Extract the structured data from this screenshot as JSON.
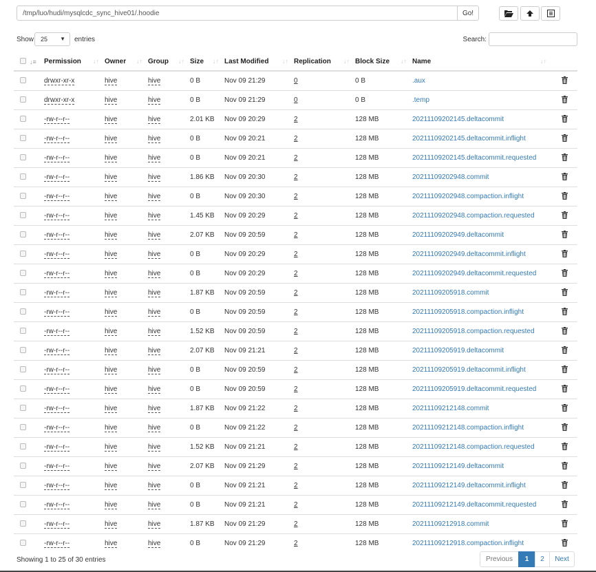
{
  "path": {
    "value": "/tmp/luo/hudi/mysqlcdc_sync_hive01/.hoodie",
    "go_label": "Go!"
  },
  "toolbar": {
    "icons": [
      "folder-open-icon",
      "upload-icon",
      "list-alt-icon"
    ]
  },
  "length": {
    "show_label": "Show",
    "selected": "25",
    "entries_label": "entries"
  },
  "search": {
    "label": "Search:",
    "value": ""
  },
  "columns": [
    "Permission",
    "Owner",
    "Group",
    "Size",
    "Last Modified",
    "Replication",
    "Block Size",
    "Name"
  ],
  "rows": [
    {
      "perm": "drwxr-xr-x",
      "owner": "hive",
      "group": "hive",
      "size": "0 B",
      "mod": "Nov 09 21:29",
      "rep": "0",
      "block": "0 B",
      "name": ".aux"
    },
    {
      "perm": "drwxr-xr-x",
      "owner": "hive",
      "group": "hive",
      "size": "0 B",
      "mod": "Nov 09 21:29",
      "rep": "0",
      "block": "0 B",
      "name": ".temp"
    },
    {
      "perm": "-rw-r--r--",
      "owner": "hive",
      "group": "hive",
      "size": "2.01 KB",
      "mod": "Nov 09 20:29",
      "rep": "2",
      "block": "128 MB",
      "name": "20211109202145.deltacommit"
    },
    {
      "perm": "-rw-r--r--",
      "owner": "hive",
      "group": "hive",
      "size": "0 B",
      "mod": "Nov 09 20:21",
      "rep": "2",
      "block": "128 MB",
      "name": "20211109202145.deltacommit.inflight"
    },
    {
      "perm": "-rw-r--r--",
      "owner": "hive",
      "group": "hive",
      "size": "0 B",
      "mod": "Nov 09 20:21",
      "rep": "2",
      "block": "128 MB",
      "name": "20211109202145.deltacommit.requested"
    },
    {
      "perm": "-rw-r--r--",
      "owner": "hive",
      "group": "hive",
      "size": "1.86 KB",
      "mod": "Nov 09 20:30",
      "rep": "2",
      "block": "128 MB",
      "name": "20211109202948.commit"
    },
    {
      "perm": "-rw-r--r--",
      "owner": "hive",
      "group": "hive",
      "size": "0 B",
      "mod": "Nov 09 20:30",
      "rep": "2",
      "block": "128 MB",
      "name": "20211109202948.compaction.inflight"
    },
    {
      "perm": "-rw-r--r--",
      "owner": "hive",
      "group": "hive",
      "size": "1.45 KB",
      "mod": "Nov 09 20:29",
      "rep": "2",
      "block": "128 MB",
      "name": "20211109202948.compaction.requested"
    },
    {
      "perm": "-rw-r--r--",
      "owner": "hive",
      "group": "hive",
      "size": "2.07 KB",
      "mod": "Nov 09 20:59",
      "rep": "2",
      "block": "128 MB",
      "name": "20211109202949.deltacommit"
    },
    {
      "perm": "-rw-r--r--",
      "owner": "hive",
      "group": "hive",
      "size": "0 B",
      "mod": "Nov 09 20:29",
      "rep": "2",
      "block": "128 MB",
      "name": "20211109202949.deltacommit.inflight"
    },
    {
      "perm": "-rw-r--r--",
      "owner": "hive",
      "group": "hive",
      "size": "0 B",
      "mod": "Nov 09 20:29",
      "rep": "2",
      "block": "128 MB",
      "name": "20211109202949.deltacommit.requested"
    },
    {
      "perm": "-rw-r--r--",
      "owner": "hive",
      "group": "hive",
      "size": "1.87 KB",
      "mod": "Nov 09 20:59",
      "rep": "2",
      "block": "128 MB",
      "name": "20211109205918.commit"
    },
    {
      "perm": "-rw-r--r--",
      "owner": "hive",
      "group": "hive",
      "size": "0 B",
      "mod": "Nov 09 20:59",
      "rep": "2",
      "block": "128 MB",
      "name": "20211109205918.compaction.inflight"
    },
    {
      "perm": "-rw-r--r--",
      "owner": "hive",
      "group": "hive",
      "size": "1.52 KB",
      "mod": "Nov 09 20:59",
      "rep": "2",
      "block": "128 MB",
      "name": "20211109205918.compaction.requested"
    },
    {
      "perm": "-rw-r--r--",
      "owner": "hive",
      "group": "hive",
      "size": "2.07 KB",
      "mod": "Nov 09 21:21",
      "rep": "2",
      "block": "128 MB",
      "name": "20211109205919.deltacommit"
    },
    {
      "perm": "-rw-r--r--",
      "owner": "hive",
      "group": "hive",
      "size": "0 B",
      "mod": "Nov 09 20:59",
      "rep": "2",
      "block": "128 MB",
      "name": "20211109205919.deltacommit.inflight"
    },
    {
      "perm": "-rw-r--r--",
      "owner": "hive",
      "group": "hive",
      "size": "0 B",
      "mod": "Nov 09 20:59",
      "rep": "2",
      "block": "128 MB",
      "name": "20211109205919.deltacommit.requested"
    },
    {
      "perm": "-rw-r--r--",
      "owner": "hive",
      "group": "hive",
      "size": "1.87 KB",
      "mod": "Nov 09 21:22",
      "rep": "2",
      "block": "128 MB",
      "name": "20211109212148.commit"
    },
    {
      "perm": "-rw-r--r--",
      "owner": "hive",
      "group": "hive",
      "size": "0 B",
      "mod": "Nov 09 21:22",
      "rep": "2",
      "block": "128 MB",
      "name": "20211109212148.compaction.inflight"
    },
    {
      "perm": "-rw-r--r--",
      "owner": "hive",
      "group": "hive",
      "size": "1.52 KB",
      "mod": "Nov 09 21:21",
      "rep": "2",
      "block": "128 MB",
      "name": "20211109212148.compaction.requested"
    },
    {
      "perm": "-rw-r--r--",
      "owner": "hive",
      "group": "hive",
      "size": "2.07 KB",
      "mod": "Nov 09 21:29",
      "rep": "2",
      "block": "128 MB",
      "name": "20211109212149.deltacommit"
    },
    {
      "perm": "-rw-r--r--",
      "owner": "hive",
      "group": "hive",
      "size": "0 B",
      "mod": "Nov 09 21:21",
      "rep": "2",
      "block": "128 MB",
      "name": "20211109212149.deltacommit.inflight"
    },
    {
      "perm": "-rw-r--r--",
      "owner": "hive",
      "group": "hive",
      "size": "0 B",
      "mod": "Nov 09 21:21",
      "rep": "2",
      "block": "128 MB",
      "name": "20211109212149.deltacommit.requested"
    },
    {
      "perm": "-rw-r--r--",
      "owner": "hive",
      "group": "hive",
      "size": "1.87 KB",
      "mod": "Nov 09 21:29",
      "rep": "2",
      "block": "128 MB",
      "name": "20211109212918.commit"
    },
    {
      "perm": "-rw-r--r--",
      "owner": "hive",
      "group": "hive",
      "size": "0 B",
      "mod": "Nov 09 21:29",
      "rep": "2",
      "block": "128 MB",
      "name": "20211109212918.compaction.inflight"
    }
  ],
  "footer": {
    "info": "Showing 1 to 25 of 30 entries",
    "prev": "Previous",
    "pages": [
      "1",
      "2"
    ],
    "next": "Next"
  },
  "colors": {
    "link": "#337ab7",
    "active_page": "#337ab7"
  }
}
